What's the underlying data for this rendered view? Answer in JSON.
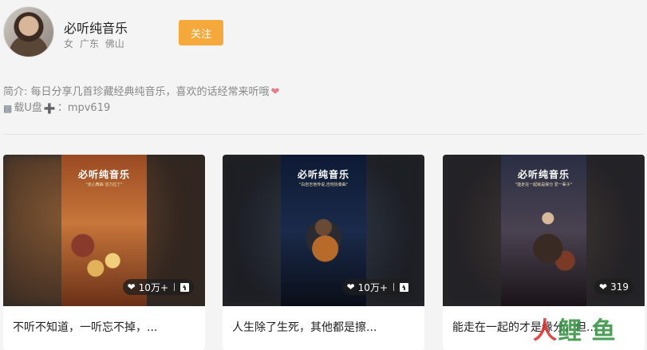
{
  "profile": {
    "name": "必听纯音乐",
    "gender": "女",
    "province": "广东",
    "city": "佛山",
    "follow_label": "关注"
  },
  "bio": {
    "line1": "简介: 每日分享几首珍藏经典纯音乐，喜欢的话经常来听哦",
    "line2_text": "载U盘",
    "line2_id": "：mpv619"
  },
  "cards": [
    {
      "poster_title": "必听纯音乐",
      "poster_sub": "\"走心舞曲 活力拉丁\"",
      "likes": "10万+",
      "caption": "不听不知道，一听忘不掉，..."
    },
    {
      "poster_title": "必听纯音乐",
      "poster_sub": "\"白岩吉他传说,吉他协奏曲\"",
      "likes": "10万+",
      "caption": "人生除了生死，其他都是擦..."
    },
    {
      "poster_title": "必听纯音乐",
      "poster_sub": "\"能走在一起就是缘分 爱一辈子\"",
      "likes": "319",
      "caption": "能走在一起的才是缘分，但..."
    }
  ],
  "watermark": {
    "part1": "人",
    "part2": "鲤 鱼"
  },
  "colors": {
    "accent": "#f5a93b",
    "background": "#f4f4f4"
  }
}
